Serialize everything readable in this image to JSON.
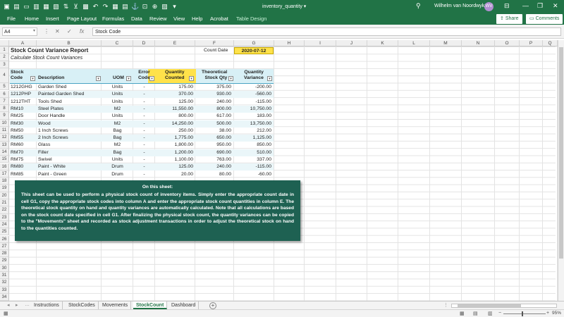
{
  "window": {
    "doc_title": "inventory_quantity",
    "user_name": "Wilhelm van Noordwyk",
    "user_initials": "WV"
  },
  "menu": [
    "File",
    "Home",
    "Insert",
    "Page Layout",
    "Formulas",
    "Data",
    "Review",
    "View",
    "Help",
    "Acrobat",
    "Table Design"
  ],
  "menu_share": "Share",
  "menu_comments": "Comments",
  "formula_bar": {
    "name_box": "A4",
    "formula": "Stock Code"
  },
  "columns": [
    "A",
    "B",
    "C",
    "D",
    "E",
    "F",
    "G",
    "H",
    "I",
    "J",
    "K",
    "L",
    "M",
    "N",
    "O",
    "P",
    "Q"
  ],
  "row_numbers": [
    "1",
    "2",
    "3",
    "4",
    "5",
    "6",
    "7",
    "8",
    "9",
    "10",
    "11",
    "12",
    "13",
    "14",
    "15",
    "16",
    "17",
    "18",
    "19",
    "20",
    "21",
    "22",
    "23",
    "24",
    "25",
    "26",
    "27",
    "28",
    "29",
    "30",
    "31",
    "32",
    "33",
    "34"
  ],
  "sheet": {
    "title": "Stock Count Variance Report",
    "subtitle": "Calculate Stock Count Variances",
    "count_date_label": "Count Date",
    "count_date": "2020-07-12",
    "headers": {
      "stock_code": [
        "Stock",
        "Code"
      ],
      "description": "Description",
      "uom": "UOM",
      "error_code": [
        "Error",
        "Code"
      ],
      "qty_counted": [
        "Quantity",
        "Counted"
      ],
      "theoretical": [
        "Theoretical",
        "Stock Qty"
      ],
      "variance": [
        "Quantity",
        "Variance"
      ]
    },
    "rows": [
      {
        "code": "1212GHG",
        "desc": "Garden Shed",
        "uom": "Units",
        "err": "-",
        "counted": "175.00",
        "theo": "375.00",
        "var": "-200.00"
      },
      {
        "code": "1212PHP",
        "desc": "Painted Garden Shed",
        "uom": "Units",
        "err": "-",
        "counted": "370.00",
        "theo": "930.00",
        "var": "-560.00"
      },
      {
        "code": "1212THT",
        "desc": "Tools Shed",
        "uom": "Units",
        "err": "-",
        "counted": "125.00",
        "theo": "240.00",
        "var": "-115.00"
      },
      {
        "code": "RM10",
        "desc": "Steel Plates",
        "uom": "M2",
        "err": "-",
        "counted": "11,550.00",
        "theo": "800.00",
        "var": "10,750.00"
      },
      {
        "code": "RM25",
        "desc": "Door Handle",
        "uom": "Units",
        "err": "-",
        "counted": "800.00",
        "theo": "617.00",
        "var": "183.00"
      },
      {
        "code": "RM30",
        "desc": "Wood",
        "uom": "M2",
        "err": "-",
        "counted": "14,250.00",
        "theo": "500.00",
        "var": "13,750.00"
      },
      {
        "code": "RM50",
        "desc": "1 Inch Screws",
        "uom": "Bag",
        "err": "-",
        "counted": "250.00",
        "theo": "38.00",
        "var": "212.00"
      },
      {
        "code": "RM55",
        "desc": "2 Inch Screws",
        "uom": "Bag",
        "err": "-",
        "counted": "1,775.00",
        "theo": "650.00",
        "var": "1,125.00"
      },
      {
        "code": "RM60",
        "desc": "Glass",
        "uom": "M2",
        "err": "-",
        "counted": "1,800.00",
        "theo": "950.00",
        "var": "850.00"
      },
      {
        "code": "RM70",
        "desc": "Filler",
        "uom": "Bag",
        "err": "-",
        "counted": "1,200.00",
        "theo": "690.00",
        "var": "510.00"
      },
      {
        "code": "RM75",
        "desc": "Swivel",
        "uom": "Units",
        "err": "-",
        "counted": "1,100.00",
        "theo": "763.00",
        "var": "337.00"
      },
      {
        "code": "RM80",
        "desc": "Paint - White",
        "uom": "Drum",
        "err": "-",
        "counted": "125.00",
        "theo": "240.00",
        "var": "-115.00"
      },
      {
        "code": "RM85",
        "desc": "Paint - Green",
        "uom": "Drum",
        "err": "-",
        "counted": "20.00",
        "theo": "80.00",
        "var": "-60.00"
      }
    ]
  },
  "note": {
    "title": "On this sheet:",
    "body": "This sheet can be used to perform a physical stock count of inventory items. Simply enter the appropriate count date in cell G1, copy the appropriate stock codes into column A and enter the appropriate stock count quantities in column E. The theoretical stock quantity on hand and quantity variances are automatically calculated. Note that all calculations are based on the stock count date specified in cell G1. After finalizing the physical stock count, the quantity variances can be copied to the \"Movements\" sheet and recorded as stock adjustment transactions in order to adjust the theoretical stock on hand to the quantities counted."
  },
  "tabs": [
    "Instructions",
    "StockCodes",
    "Movements",
    "StockCount",
    "Dashboard"
  ],
  "active_tab": "StockCount",
  "zoom": "95%"
}
